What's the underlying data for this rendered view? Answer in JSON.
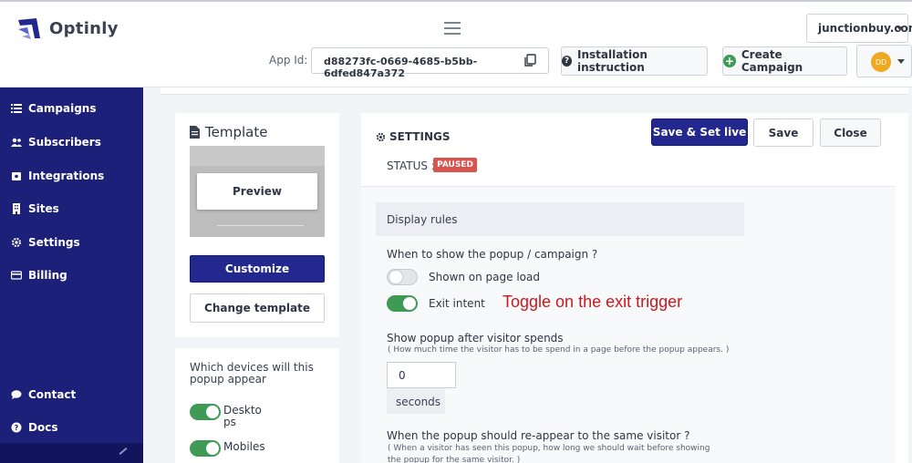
{
  "header": {
    "brand": "Optinly",
    "site_select": "junctionbuy.com",
    "app_id_label": "App Id:",
    "app_id": "d88273fc-0669-4685-b5bb-6dfed847a372",
    "install_button": "Installation instruction",
    "create_button": "Create Campaign",
    "avatar_initials": "DD"
  },
  "sidebar": {
    "items": [
      {
        "label": "Campaigns",
        "icon": "list-icon"
      },
      {
        "label": "Subscribers",
        "icon": "users-icon"
      },
      {
        "label": "Integrations",
        "icon": "puzzle-icon"
      },
      {
        "label": "Sites",
        "icon": "building-icon"
      },
      {
        "label": "Settings",
        "icon": "gear-icon"
      },
      {
        "label": "Billing",
        "icon": "credit-card-icon"
      }
    ],
    "bottom_items": [
      {
        "label": "Contact",
        "icon": "chat-icon"
      },
      {
        "label": "Docs",
        "icon": "question-icon"
      }
    ]
  },
  "template_panel": {
    "title": "Template",
    "preview_button": "Preview",
    "customize_button": "Customize",
    "change_button": "Change template",
    "devices_title": "Which devices will this popup appear",
    "devices": [
      {
        "label": "Deskto ps",
        "enabled": true
      },
      {
        "label": "Mobiles",
        "enabled": true
      }
    ]
  },
  "settings_panel": {
    "title": "SETTINGS",
    "status_label": "STATUS :",
    "status_value": "PAUSED",
    "save_live_button": "Save & Set live",
    "save_button": "Save",
    "close_button": "Close",
    "display_rules": "Display rules",
    "when_question": "When to show the popup / campaign ?",
    "trigger_page_load": "Shown on page load",
    "trigger_page_load_on": false,
    "trigger_exit": "Exit intent",
    "trigger_exit_on": true,
    "annotation": "Toggle on the exit trigger",
    "spend_label": "Show popup after visitor spends",
    "spend_help": "( How much time the visitor has to be spend in a page before the popup appears. )",
    "spend_value": "0",
    "spend_unit": "seconds",
    "reappear_label": "When the popup should re-appear to the same visitor ?",
    "reappear_help": "( When a visitor has seen this popup, how long we should wait before showing the popup for the same visitor. )"
  },
  "colors": {
    "sidebar": "#1c2078",
    "primary": "#23288e",
    "toggle_on": "#3f9a55",
    "paused_badge": "#d9534f",
    "annotation": "#d0161c"
  }
}
